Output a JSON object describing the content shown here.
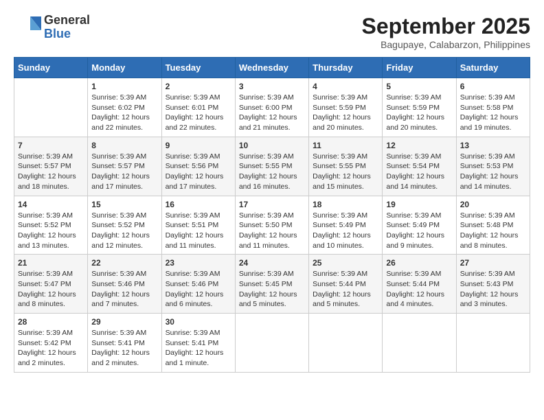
{
  "header": {
    "logo_line1": "General",
    "logo_line2": "Blue",
    "title": "September 2025",
    "subtitle": "Bagupaye, Calabarzon, Philippines"
  },
  "days_of_week": [
    "Sunday",
    "Monday",
    "Tuesday",
    "Wednesday",
    "Thursday",
    "Friday",
    "Saturday"
  ],
  "weeks": [
    [
      {
        "day": "",
        "content": ""
      },
      {
        "day": "1",
        "content": "Sunrise: 5:39 AM\nSunset: 6:02 PM\nDaylight: 12 hours\nand 22 minutes."
      },
      {
        "day": "2",
        "content": "Sunrise: 5:39 AM\nSunset: 6:01 PM\nDaylight: 12 hours\nand 22 minutes."
      },
      {
        "day": "3",
        "content": "Sunrise: 5:39 AM\nSunset: 6:00 PM\nDaylight: 12 hours\nand 21 minutes."
      },
      {
        "day": "4",
        "content": "Sunrise: 5:39 AM\nSunset: 5:59 PM\nDaylight: 12 hours\nand 20 minutes."
      },
      {
        "day": "5",
        "content": "Sunrise: 5:39 AM\nSunset: 5:59 PM\nDaylight: 12 hours\nand 20 minutes."
      },
      {
        "day": "6",
        "content": "Sunrise: 5:39 AM\nSunset: 5:58 PM\nDaylight: 12 hours\nand 19 minutes."
      }
    ],
    [
      {
        "day": "7",
        "content": "Sunrise: 5:39 AM\nSunset: 5:57 PM\nDaylight: 12 hours\nand 18 minutes."
      },
      {
        "day": "8",
        "content": "Sunrise: 5:39 AM\nSunset: 5:57 PM\nDaylight: 12 hours\nand 17 minutes."
      },
      {
        "day": "9",
        "content": "Sunrise: 5:39 AM\nSunset: 5:56 PM\nDaylight: 12 hours\nand 17 minutes."
      },
      {
        "day": "10",
        "content": "Sunrise: 5:39 AM\nSunset: 5:55 PM\nDaylight: 12 hours\nand 16 minutes."
      },
      {
        "day": "11",
        "content": "Sunrise: 5:39 AM\nSunset: 5:55 PM\nDaylight: 12 hours\nand 15 minutes."
      },
      {
        "day": "12",
        "content": "Sunrise: 5:39 AM\nSunset: 5:54 PM\nDaylight: 12 hours\nand 14 minutes."
      },
      {
        "day": "13",
        "content": "Sunrise: 5:39 AM\nSunset: 5:53 PM\nDaylight: 12 hours\nand 14 minutes."
      }
    ],
    [
      {
        "day": "14",
        "content": "Sunrise: 5:39 AM\nSunset: 5:52 PM\nDaylight: 12 hours\nand 13 minutes."
      },
      {
        "day": "15",
        "content": "Sunrise: 5:39 AM\nSunset: 5:52 PM\nDaylight: 12 hours\nand 12 minutes."
      },
      {
        "day": "16",
        "content": "Sunrise: 5:39 AM\nSunset: 5:51 PM\nDaylight: 12 hours\nand 11 minutes."
      },
      {
        "day": "17",
        "content": "Sunrise: 5:39 AM\nSunset: 5:50 PM\nDaylight: 12 hours\nand 11 minutes."
      },
      {
        "day": "18",
        "content": "Sunrise: 5:39 AM\nSunset: 5:49 PM\nDaylight: 12 hours\nand 10 minutes."
      },
      {
        "day": "19",
        "content": "Sunrise: 5:39 AM\nSunset: 5:49 PM\nDaylight: 12 hours\nand 9 minutes."
      },
      {
        "day": "20",
        "content": "Sunrise: 5:39 AM\nSunset: 5:48 PM\nDaylight: 12 hours\nand 8 minutes."
      }
    ],
    [
      {
        "day": "21",
        "content": "Sunrise: 5:39 AM\nSunset: 5:47 PM\nDaylight: 12 hours\nand 8 minutes."
      },
      {
        "day": "22",
        "content": "Sunrise: 5:39 AM\nSunset: 5:46 PM\nDaylight: 12 hours\nand 7 minutes."
      },
      {
        "day": "23",
        "content": "Sunrise: 5:39 AM\nSunset: 5:46 PM\nDaylight: 12 hours\nand 6 minutes."
      },
      {
        "day": "24",
        "content": "Sunrise: 5:39 AM\nSunset: 5:45 PM\nDaylight: 12 hours\nand 5 minutes."
      },
      {
        "day": "25",
        "content": "Sunrise: 5:39 AM\nSunset: 5:44 PM\nDaylight: 12 hours\nand 5 minutes."
      },
      {
        "day": "26",
        "content": "Sunrise: 5:39 AM\nSunset: 5:44 PM\nDaylight: 12 hours\nand 4 minutes."
      },
      {
        "day": "27",
        "content": "Sunrise: 5:39 AM\nSunset: 5:43 PM\nDaylight: 12 hours\nand 3 minutes."
      }
    ],
    [
      {
        "day": "28",
        "content": "Sunrise: 5:39 AM\nSunset: 5:42 PM\nDaylight: 12 hours\nand 2 minutes."
      },
      {
        "day": "29",
        "content": "Sunrise: 5:39 AM\nSunset: 5:41 PM\nDaylight: 12 hours\nand 2 minutes."
      },
      {
        "day": "30",
        "content": "Sunrise: 5:39 AM\nSunset: 5:41 PM\nDaylight: 12 hours\nand 1 minute."
      },
      {
        "day": "",
        "content": ""
      },
      {
        "day": "",
        "content": ""
      },
      {
        "day": "",
        "content": ""
      },
      {
        "day": "",
        "content": ""
      }
    ]
  ]
}
